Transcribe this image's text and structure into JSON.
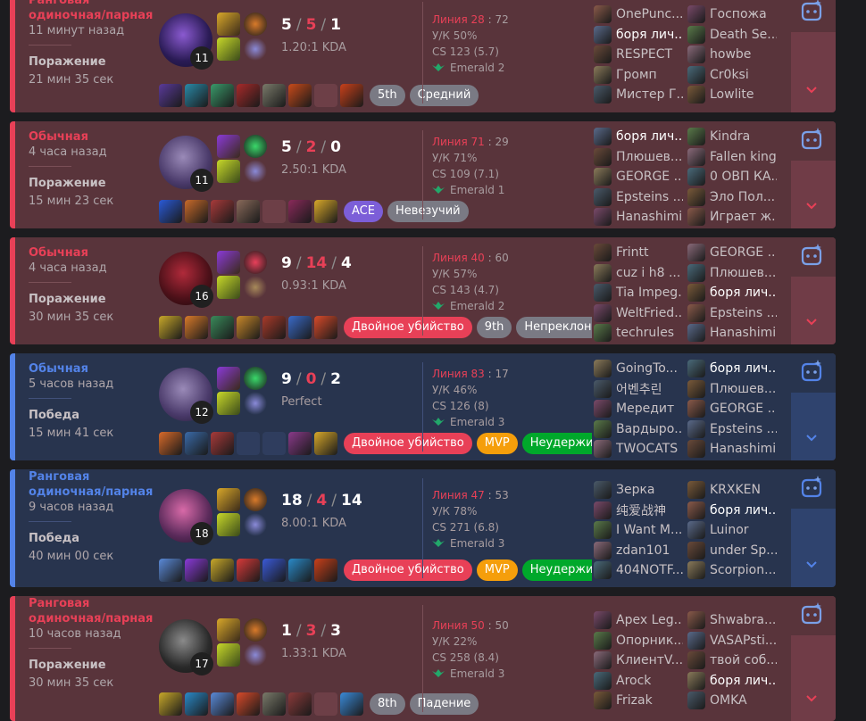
{
  "colors": {
    "loss": "#e84057",
    "win": "#5383e8"
  },
  "matches": [
    {
      "result_class": "loss",
      "queue": "Ранговая одиночная/парная",
      "ago": "11 минут назад",
      "result": "Поражение",
      "duration": "21 мин 35 сек",
      "level": "11",
      "kills": "5",
      "deaths": "5",
      "assists": "1",
      "ratio": "1.20:1 KDA",
      "badges": [
        {
          "text": "5th",
          "cls": "b-gray"
        },
        {
          "text": "Средний",
          "cls": "b-gray"
        }
      ],
      "lane": "Линия 28",
      "lane_num": "72",
      "kp": "У/К 50%",
      "cs": "CS 123 (5.7)",
      "rank": "Emerald 2",
      "players": [
        "OnePunc...",
        "боря лич...",
        "RESPECT",
        "Громп",
        "Мистер Г...",
        "Госпожа",
        "Death Se...",
        "howbe",
        "Cr0ksi",
        "Lowlite"
      ]
    },
    {
      "result_class": "loss",
      "queue": "Обычная",
      "ago": "4 часа назад",
      "result": "Поражение",
      "duration": "15 мин 23 сек",
      "level": "11",
      "kills": "5",
      "deaths": "2",
      "assists": "0",
      "ratio": "2.50:1 KDA",
      "badges": [
        {
          "text": "ACE",
          "cls": "b-purple"
        },
        {
          "text": "Невезучий",
          "cls": "b-gray"
        }
      ],
      "lane": "Линия 71",
      "lane_num": "29",
      "kp": "У/К 71%",
      "cs": "CS 109 (7.1)",
      "rank": "Emerald 1",
      "players": [
        "боря лич...",
        "Плюшев...",
        "GEORGE ...",
        "Epsteins ...",
        "Hanashimi",
        "Kindra",
        "Fallen king",
        "0 ОВП КА...",
        "Эло Пол...",
        "Играет ж..."
      ]
    },
    {
      "result_class": "loss",
      "queue": "Обычная",
      "ago": "4 часа назад",
      "result": "Поражение",
      "duration": "30 мин 35 сек",
      "level": "16",
      "kills": "9",
      "deaths": "14",
      "assists": "4",
      "ratio": "0.93:1 KDA",
      "badges": [
        {
          "text": "Двойное убийство",
          "cls": "b-red"
        },
        {
          "text": "9th",
          "cls": "b-gray"
        },
        {
          "text": "Непреклонный",
          "cls": "b-gray"
        }
      ],
      "lane": "Линия 40",
      "lane_num": "60",
      "kp": "У/К 57%",
      "cs": "CS 143 (4.7)",
      "rank": "Emerald 2",
      "players": [
        "Frintt",
        "cuz i h8 ...",
        "Tia Impeg...",
        "WeltFried...",
        "techrules",
        "GEORGE ...",
        "Плюшев...",
        "боря лич...",
        "Epsteins ...",
        "Hanashimi"
      ]
    },
    {
      "result_class": "win",
      "queue": "Обычная",
      "ago": "5 часов назад",
      "result": "Победа",
      "duration": "15 мин 41 сек",
      "level": "12",
      "kills": "9",
      "deaths": "0",
      "assists": "2",
      "ratio": "Perfect",
      "badges": [
        {
          "text": "Двойное убийство",
          "cls": "b-red"
        },
        {
          "text": "MVP",
          "cls": "b-orange"
        },
        {
          "text": "Неудержимый",
          "cls": "b-green"
        }
      ],
      "lane": "Линия 83",
      "lane_num": "17",
      "kp": "У/К 46%",
      "cs": "CS 126 (8)",
      "rank": "Emerald 3",
      "players": [
        "GoingTo...",
        "어벤추린",
        "Мередит",
        "Вардыро...",
        "TWOCATS",
        "боря лич...",
        "Плюшев...",
        "GEORGE ...",
        "Epsteins ...",
        "Hanashimi"
      ]
    },
    {
      "result_class": "win",
      "queue": "Ранговая одиночная/парная",
      "ago": "9 часов назад",
      "result": "Победа",
      "duration": "40 мин 00 сек",
      "level": "18",
      "kills": "18",
      "deaths": "4",
      "assists": "14",
      "ratio": "8.00:1 KDA",
      "badges": [
        {
          "text": "Двойное убийство",
          "cls": "b-red"
        },
        {
          "text": "MVP",
          "cls": "b-orange"
        },
        {
          "text": "Неудержимый",
          "cls": "b-green"
        }
      ],
      "lane": "Линия 47",
      "lane_num": "53",
      "kp": "У/К 78%",
      "cs": "CS 271 (6.8)",
      "rank": "Emerald 3",
      "players": [
        "Зерка",
        "纯爱战神",
        "I Want M...",
        "zdan101",
        "404NOTF...",
        "KRXKEN",
        "боря лич...",
        "Luinor",
        "under Sp...",
        "Scorpion..."
      ]
    },
    {
      "result_class": "loss",
      "queue": "Ранговая одиночная/парная",
      "ago": "10 часов назад",
      "result": "Поражение",
      "duration": "30 мин 35 сек",
      "level": "17",
      "kills": "1",
      "deaths": "3",
      "assists": "3",
      "ratio": "1.33:1 KDA",
      "badges": [
        {
          "text": "8th",
          "cls": "b-gray"
        },
        {
          "text": "Падение",
          "cls": "b-gray"
        }
      ],
      "lane": "Линия 50",
      "lane_num": "50",
      "kp": "У/К 22%",
      "cs": "CS 258 (8.4)",
      "rank": "Emerald 3",
      "players": [
        "Apex Leg...",
        "Опорник...",
        "КлиентV...",
        "Arock",
        "Frizak",
        "Shwabra...",
        "VASAPsti...",
        "твой соб...",
        "боря лич...",
        "OMKA"
      ]
    }
  ]
}
